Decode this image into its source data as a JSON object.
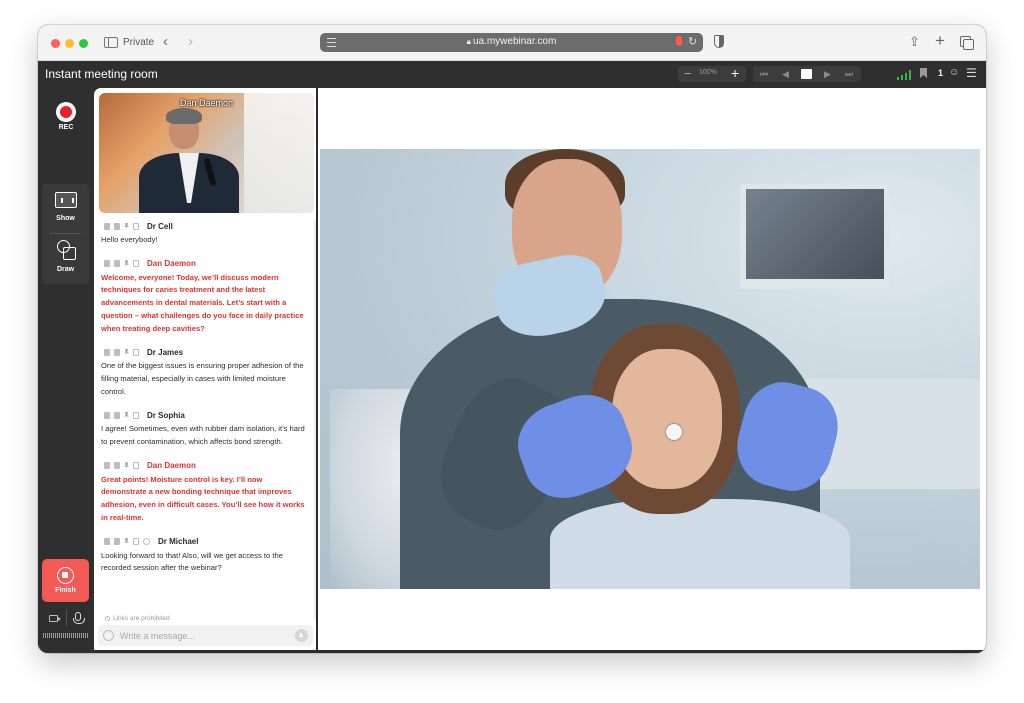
{
  "browser": {
    "mode_label": "Private",
    "url": "ua.mywebinar.com"
  },
  "app": {
    "room_title": "Instant meeting room",
    "zoom": "100%",
    "participant_count": "1"
  },
  "rail": {
    "rec_label": "REC",
    "show_label": "Show",
    "draw_label": "Draw",
    "finish_label": "Finish"
  },
  "speaker": {
    "name": "Dan Daemon"
  },
  "chat": {
    "messages": [
      {
        "author": "Dr Cell",
        "text": "Hello everybody!"
      },
      {
        "author": "Dan Daemon",
        "text": "Welcome, everyone! Today, we’ll discuss modern techniques for caries treatment and the latest advancements in dental materials. Let’s start with a question – what challenges do you face in daily practice when treating deep cavities?"
      },
      {
        "author": "Dr James",
        "text": "One of the biggest issues is ensuring proper adhesion of the filling material, especially in cases with limited moisture control."
      },
      {
        "author": "Dr Sophia",
        "text": "I agree! Sometimes, even with rubber dam isolation, it’s hard to prevent contamination, which affects bond strength."
      },
      {
        "author": "Dan Daemon",
        "text": "Great points! Moisture control is key. I’ll now demonstrate a new bonding technique that improves adhesion, even in difficult cases. You’ll see how it works in real-time."
      },
      {
        "author": "Dr Michael",
        "text": "Looking forward to that! Also, will we get access to the recorded session after the webinar?"
      }
    ],
    "links_note": "Links are prohibited",
    "input_placeholder": "Write a message..."
  },
  "colors": {
    "host_text": "#e03131",
    "finish_button": "#f45a55",
    "rec_dot": "#e4202c",
    "signal": "#3bb34a"
  },
  "icons": [
    "sidebar-icon",
    "back-icon",
    "forward-icon",
    "lock-icon",
    "mic-icon",
    "reload-icon",
    "shield-icon",
    "share-icon",
    "new-tab-icon",
    "tabs-icon",
    "signal-icon",
    "bookmark-icon",
    "users-icon",
    "menu-icon",
    "rec-icon",
    "presentation-icon",
    "draw-icon",
    "stop-icon",
    "camera-icon",
    "emoji-icon",
    "send-icon"
  ]
}
